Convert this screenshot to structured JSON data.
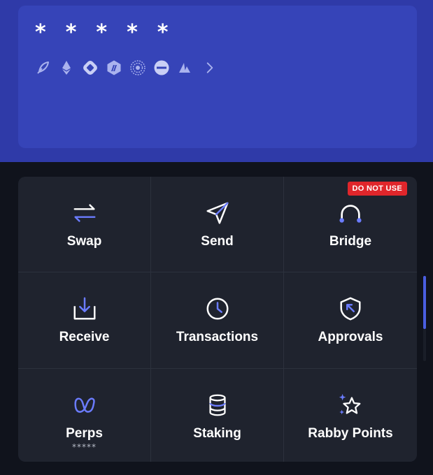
{
  "balance": {
    "masked": "*****"
  },
  "chains": [
    {
      "icon": "feather-chain-icon"
    },
    {
      "icon": "ethereum-icon"
    },
    {
      "icon": "diamond-chain-icon"
    },
    {
      "icon": "arbitrum-icon"
    },
    {
      "icon": "spiral-chain-icon"
    },
    {
      "icon": "minus-circle-chain-icon"
    },
    {
      "icon": "triangle-chain-icon"
    }
  ],
  "actions": [
    {
      "label": "Swap",
      "icon": "swap-arrows-icon"
    },
    {
      "label": "Send",
      "icon": "send-plane-icon"
    },
    {
      "label": "Bridge",
      "icon": "bridge-arc-icon",
      "badge": "DO NOT USE"
    },
    {
      "label": "Receive",
      "icon": "download-tray-icon"
    },
    {
      "label": "Transactions",
      "icon": "clock-icon"
    },
    {
      "label": "Approvals",
      "icon": "shield-arrow-icon"
    },
    {
      "label": "Perps",
      "icon": "wave-icon",
      "sub": "*****"
    },
    {
      "label": "Staking",
      "icon": "database-icon"
    },
    {
      "label": "Rabby Points",
      "icon": "star-sparkle-icon"
    }
  ],
  "colors": {
    "accent": "#6b7cff",
    "card": "#3644b8",
    "badge": "#e0262b"
  }
}
